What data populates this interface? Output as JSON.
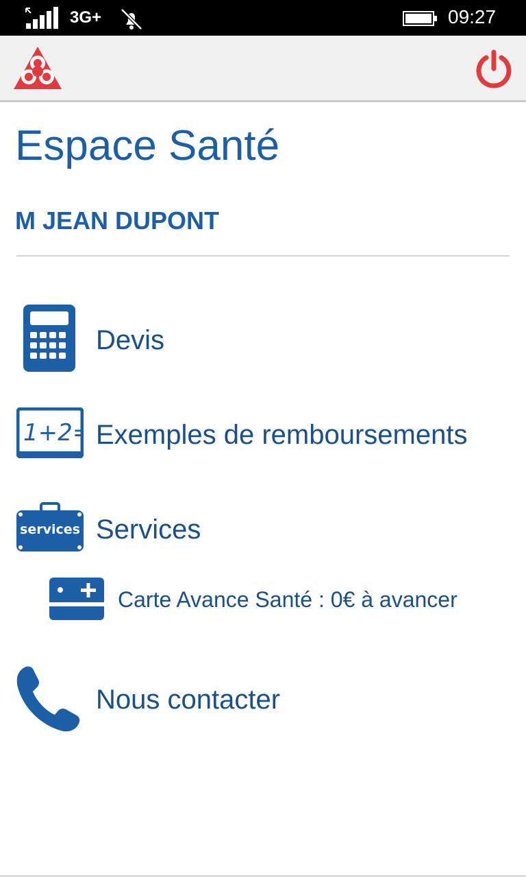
{
  "status_bar": {
    "network": "3G+",
    "time": "09:27"
  },
  "header": {
    "logo_icon": "bank-logo-icon",
    "power_icon": "power-icon",
    "accent_color": "#e23a3f"
  },
  "page": {
    "title": "Espace Santé",
    "user_name": "M JEAN DUPONT",
    "primary_color": "#1d5fa6"
  },
  "menu": {
    "items": [
      {
        "label": "Devis",
        "icon": "calculator-icon"
      },
      {
        "label": "Exemples de remboursements",
        "icon": "math-board-icon"
      },
      {
        "label": "Services",
        "icon": "services-case-icon"
      },
      {
        "label": "Nous contacter",
        "icon": "phone-icon"
      }
    ],
    "sub_items": [
      {
        "label": "Carte Avance Santé : 0€ à avancer",
        "icon": "health-card-icon"
      }
    ]
  }
}
